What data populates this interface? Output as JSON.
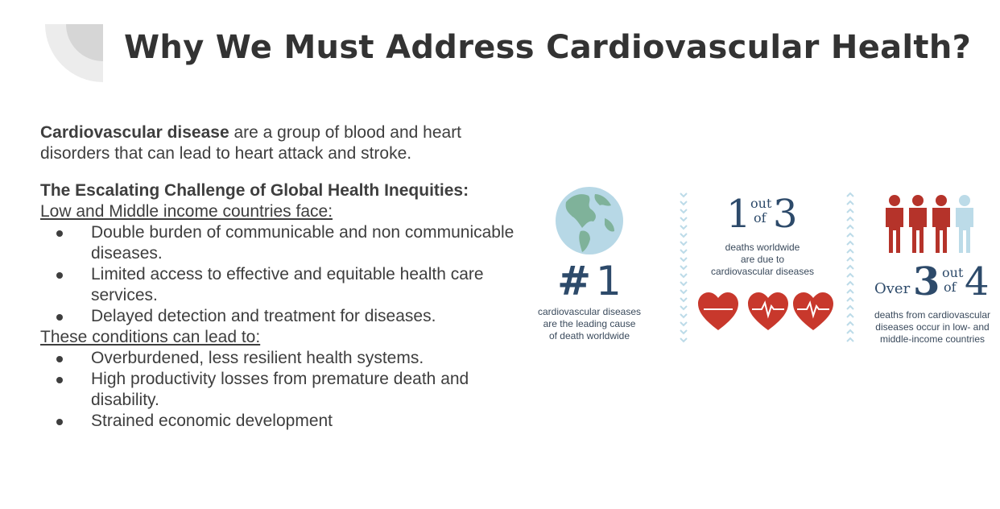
{
  "slide": {
    "title": "Why We Must Address Cardiovascular Health?"
  },
  "intro": {
    "bold_term": "Cardiovascular disease",
    "rest": " are a group of blood and heart disorders that can lead to heart attack and stroke."
  },
  "challenge": {
    "heading": "The Escalating Challenge of Global Health Inequities:",
    "face_label": "Low and Middle income countries face:",
    "face_items": [
      "Double burden of communicable and non communicable diseases.",
      "Limited access to effective and equitable health care services.",
      "Delayed detection and treatment for diseases."
    ],
    "lead_label": "These conditions can lead to:",
    "lead_items": [
      "Overburdened, less resilient health systems.",
      "High productivity losses from premature death and disability.",
      "Strained economic development"
    ]
  },
  "infographic": {
    "panel1": {
      "hash": "#",
      "number": "1",
      "caption": [
        "cardiovascular diseases",
        "are the leading cause",
        "of death worldwide"
      ]
    },
    "panel2": {
      "num1": "1",
      "out": "out",
      "of": "of",
      "num2": "3",
      "caption": [
        "deaths worldwide",
        "are due to",
        "cardiovascular diseases"
      ]
    },
    "panel3": {
      "over": "Over",
      "num1": "3",
      "out": "out",
      "of": "of",
      "num2": "4",
      "caption": [
        "deaths from cardiovascular",
        "diseases occur in low- and",
        "middle-income countries"
      ]
    }
  },
  "colors": {
    "title": "#333333",
    "body": "#3e3e3e",
    "navy": "#2d4a6a",
    "heart_red": "#c8382c",
    "person_red": "#b5332a",
    "person_light": "#bcdbe8",
    "globe_ocean": "#b7d8e6",
    "globe_land": "#7fb29a",
    "chevron": "#bcdbe8"
  },
  "icons": [
    "globe-icon",
    "heart-icon",
    "heartbeat-heart-icon",
    "person-icon",
    "chevron-divider"
  ]
}
